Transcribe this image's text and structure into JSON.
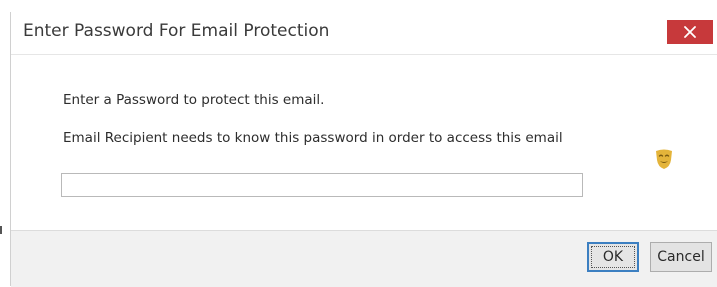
{
  "dialog": {
    "title": "Enter Password For Email Protection",
    "close_icon": "close-icon",
    "message_line1": "Enter a Password to protect this email.",
    "message_line2": "Email Recipient needs to know this password in order to access this email",
    "mask_icon": "theater-mask-icon",
    "password_value": "",
    "ok_label": "OK",
    "cancel_label": "Cancel"
  },
  "colors": {
    "close_button": "#c7393b",
    "footer_bg": "#f1f1f1",
    "focus_border": "#3c7fc1",
    "mask_icon": "#e4b43a"
  }
}
